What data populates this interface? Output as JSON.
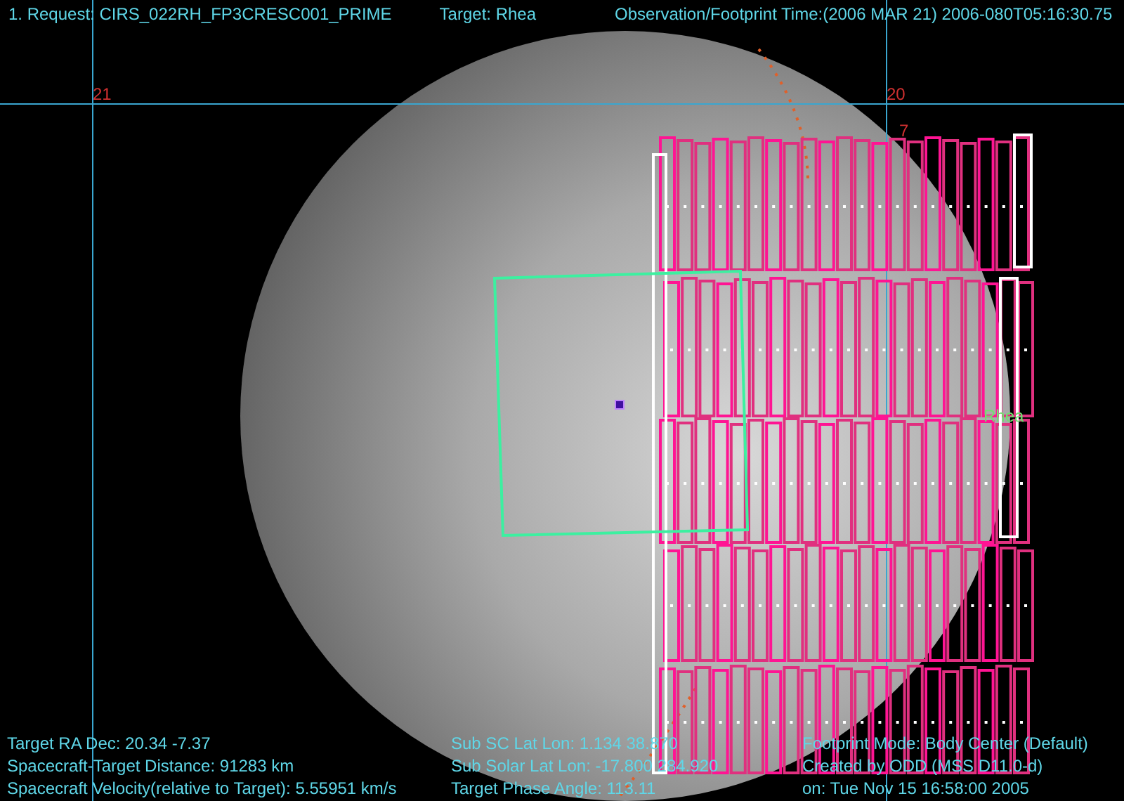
{
  "header": {
    "request": "1. Request: CIRS_022RH_FP3CRESC001_PRIME",
    "target": "Target: Rhea",
    "time": "Observation/Footprint Time:(2006 MAR 21) 2006-080T05:16:30.75"
  },
  "canvas_labels": [
    {
      "kind": "grid",
      "text": "21"
    },
    {
      "kind": "grid",
      "text": "20"
    },
    {
      "kind": "grid",
      "text": "7"
    },
    {
      "kind": "target",
      "text": "Rhea"
    }
  ],
  "footer": {
    "left": [
      "Target RA Dec: 20.34   -7.37",
      "Spacecraft-Target Distance:   91283 km",
      "Spacecraft Velocity(relative to Target): 5.55951 km/s"
    ],
    "middle": [
      "Sub SC Lat Lon:  1.134  38.870",
      "Sub Solar Lat Lon: -17.800  284.920",
      "Target Phase Angle: 113.11"
    ],
    "right": [
      "Footprint Mode: Body Center (Default)",
      "Created by ODD (MSS D11.0-d)",
      "on: Tue Nov 15 16:58:00 2005"
    ]
  }
}
